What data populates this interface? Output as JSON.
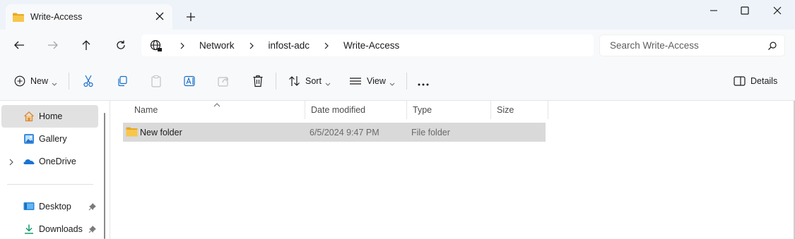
{
  "window": {
    "tab_title": "Write-Access",
    "tab_close": "×",
    "new_tab": "+"
  },
  "address": {
    "crumbs": [
      "Network",
      "infost-adc",
      "Write-Access"
    ]
  },
  "search": {
    "placeholder": "Search Write-Access"
  },
  "commands": {
    "new_label": "New",
    "sort_label": "Sort",
    "view_label": "View",
    "more_label": "···",
    "details_label": "Details"
  },
  "sidebar": {
    "items": [
      {
        "label": "Home",
        "icon": "home-icon",
        "selected": true
      },
      {
        "label": "Gallery",
        "icon": "gallery-icon"
      },
      {
        "label": "OneDrive",
        "icon": "onedrive-icon"
      },
      {
        "label": "Desktop",
        "icon": "desktop-icon",
        "pinned": true
      },
      {
        "label": "Downloads",
        "icon": "downloads-icon",
        "pinned": true
      }
    ]
  },
  "table": {
    "columns": [
      "Name",
      "Date modified",
      "Type",
      "Size"
    ],
    "rows": [
      {
        "name": "New folder",
        "date_modified": "6/5/2024 9:47 PM",
        "type": "File folder",
        "size": ""
      }
    ]
  },
  "colors": {
    "folder": "#f7c64b",
    "accent": "#0067c0",
    "selection": "#d9d9d9",
    "tabbar": "#eef3fa"
  }
}
